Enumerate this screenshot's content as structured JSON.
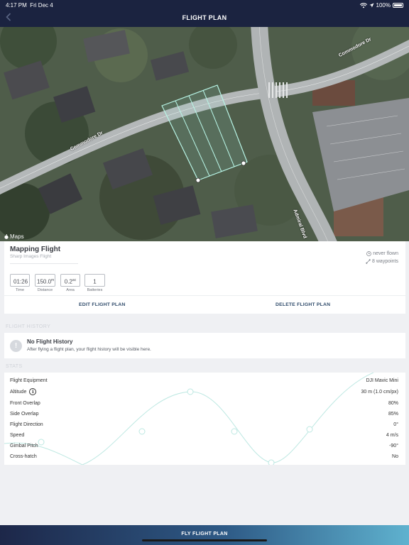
{
  "status": {
    "time": "4:17 PM",
    "date": "Fri Dec 4",
    "battery": "100%"
  },
  "header": {
    "title": "FLIGHT PLAN"
  },
  "map": {
    "credit": "Maps",
    "streets": [
      "Commodore Dr",
      "Commodore Dr",
      "Admiral Blvd"
    ]
  },
  "plan": {
    "title": "Mapping Flight",
    "subtitle": "Sharp Images Flight",
    "status": "never flown",
    "waypoints": "8 waypoints",
    "stats": [
      {
        "value": "01:26",
        "unit": "",
        "label": "Time"
      },
      {
        "value": "150.0",
        "unit": "m",
        "label": "Distance"
      },
      {
        "value": "0.2",
        "unit": "ac",
        "label": "Area"
      },
      {
        "value": "1",
        "unit": "",
        "label": "Batteries"
      }
    ],
    "edit_label": "EDIT FLIGHT PLAN",
    "delete_label": "DELETE FLIGHT PLAN"
  },
  "history": {
    "section": "FLIGHT HISTORY",
    "title": "No Flight History",
    "subtitle": "After flying a flight plan, your flight history will be visible here."
  },
  "stats": {
    "section": "STATS",
    "rows": [
      {
        "label": "Flight Equipment",
        "value": "DJI Mavic Mini"
      },
      {
        "label": "Altitude",
        "value": "30 m (1.0 cm/px)"
      },
      {
        "label": "Front Overlap",
        "value": "80%"
      },
      {
        "label": "Side Overlap",
        "value": "85%"
      },
      {
        "label": "Flight Direction",
        "value": "0°"
      },
      {
        "label": "Speed",
        "value": "4 m/s"
      },
      {
        "label": "Gimbal Pitch",
        "value": "-90°"
      },
      {
        "label": "Cross-hatch",
        "value": "No"
      }
    ]
  },
  "footer": {
    "fly_label": "FLY FLIGHT PLAN"
  },
  "colors": {
    "navbar": "#1b2340",
    "grid": "#aef3e2",
    "accent_end": "#5fb2cf"
  }
}
